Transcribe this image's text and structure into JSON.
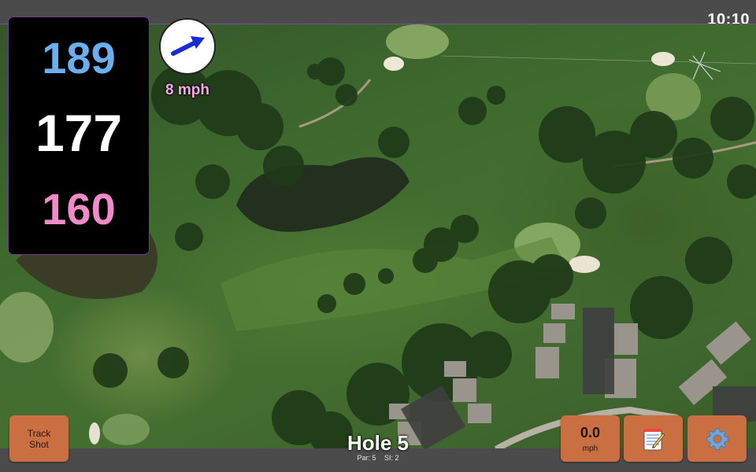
{
  "status": {
    "time": "10:10"
  },
  "yardages": {
    "back": "189",
    "center": "177",
    "front": "160"
  },
  "wind": {
    "speed_label": "8 mph",
    "direction_icon": "arrow-icon"
  },
  "hole": {
    "title": "Hole 5",
    "par": "Par: 5",
    "si": "SI: 2"
  },
  "buttons": {
    "track_shot_line1": "Track",
    "track_shot_line2": "Shot",
    "wind_value": "0.0",
    "wind_unit": "mph",
    "notes_icon": "notepad-icon",
    "settings_icon": "gear-icon"
  },
  "colors": {
    "back_yardage": "#6aaff0",
    "center_yardage": "#ffffff",
    "front_yardage": "#f08ac8",
    "button_bg": "#c96f42",
    "wind_text": "#f7a8e6"
  }
}
